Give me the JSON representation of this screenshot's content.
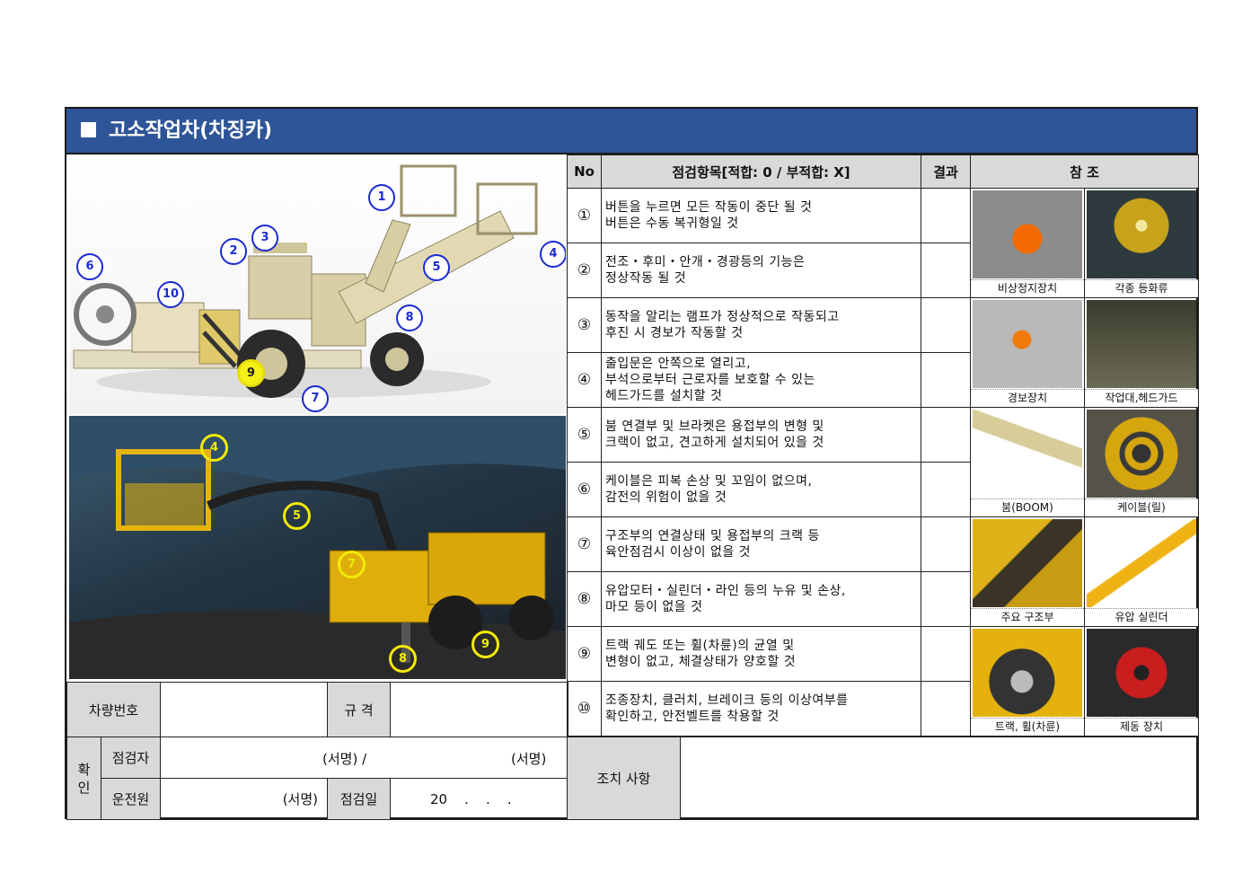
{
  "title": "고소작업차(차징카)",
  "table": {
    "headers": {
      "no": "No",
      "item": "점검항목[적합: 0 / 부적합: X]",
      "result": "결과",
      "ref": "참 조"
    },
    "rows": [
      {
        "no": "①",
        "lines": [
          "버튼을 누르면 모든 작동이 중단 될 것",
          "버튼은 수동 복귀형일 것"
        ]
      },
      {
        "no": "②",
        "lines": [
          "전조・후미・안개・경광등의 기능은",
          "정상작동 될 것"
        ]
      },
      {
        "no": "③",
        "lines": [
          "동작을 알리는 램프가 정상적으로 작동되고",
          "후진 시 경보가 작동할 것"
        ]
      },
      {
        "no": "④",
        "lines": [
          "출입문은 안쪽으로 열리고,",
          "부석으로부터 근로자를 보호할 수 있는",
          "헤드가드를 설치할 것"
        ]
      },
      {
        "no": "⑤",
        "lines": [
          "붐 연결부 및 브라켓은 용접부의 변형 및",
          "크랙이 없고, 견고하게 설치되어 있을 것"
        ]
      },
      {
        "no": "⑥",
        "lines": [
          "케이블은 피복 손상 및 꼬임이 없으며,",
          "감전의 위험이 없을 것"
        ]
      },
      {
        "no": "⑦",
        "lines": [
          "구조부의 연결상태 및 용접부의 크랙 등",
          "육안점검시 이상이 없을 것"
        ]
      },
      {
        "no": "⑧",
        "lines": [
          "유압모터・실린더・라인 등의 누유 및 손상,",
          "마모 등이 없을 것"
        ]
      },
      {
        "no": "⑨",
        "lines": [
          "트랙 궤도 또는 휠(차륜)의 균열 및",
          "변형이 없고, 체결상태가 양호할 것"
        ]
      },
      {
        "no": "⑩",
        "lines": [
          "조종장치, 클러치, 브레이크 등의 이상여부를",
          "확인하고, 안전벨트를 착용할 것"
        ]
      }
    ],
    "refs": [
      {
        "left": "비상정지장치",
        "right": "각종 등화류"
      },
      {
        "left": "경보장치",
        "right": "작업대,헤드가드"
      },
      {
        "left": "붐(BOOM)",
        "right": "케이블(릴)"
      },
      {
        "left": "주요 구조부",
        "right": "유압 실린더"
      },
      {
        "left": "트랙, 휠(차륜)",
        "right": "제동 장치"
      }
    ]
  },
  "photo_top_badges": [
    "1",
    "2",
    "3",
    "4",
    "5",
    "6",
    "7",
    "8",
    "9",
    "10"
  ],
  "photo_bottom_badges": [
    "4",
    "5",
    "7",
    "8",
    "9"
  ],
  "form": {
    "vehicle_no_label": "차량번호",
    "spec_label": "규 격",
    "confirm_label": "확\n인",
    "inspector_label": "점검자",
    "sign1": "(서명) /",
    "sign2": "(서명)",
    "driver_label": "운전원",
    "sign3": "(서명)",
    "date_label": "점검일",
    "date_value": "20    .    .    .",
    "action_label": "조치 사항"
  }
}
